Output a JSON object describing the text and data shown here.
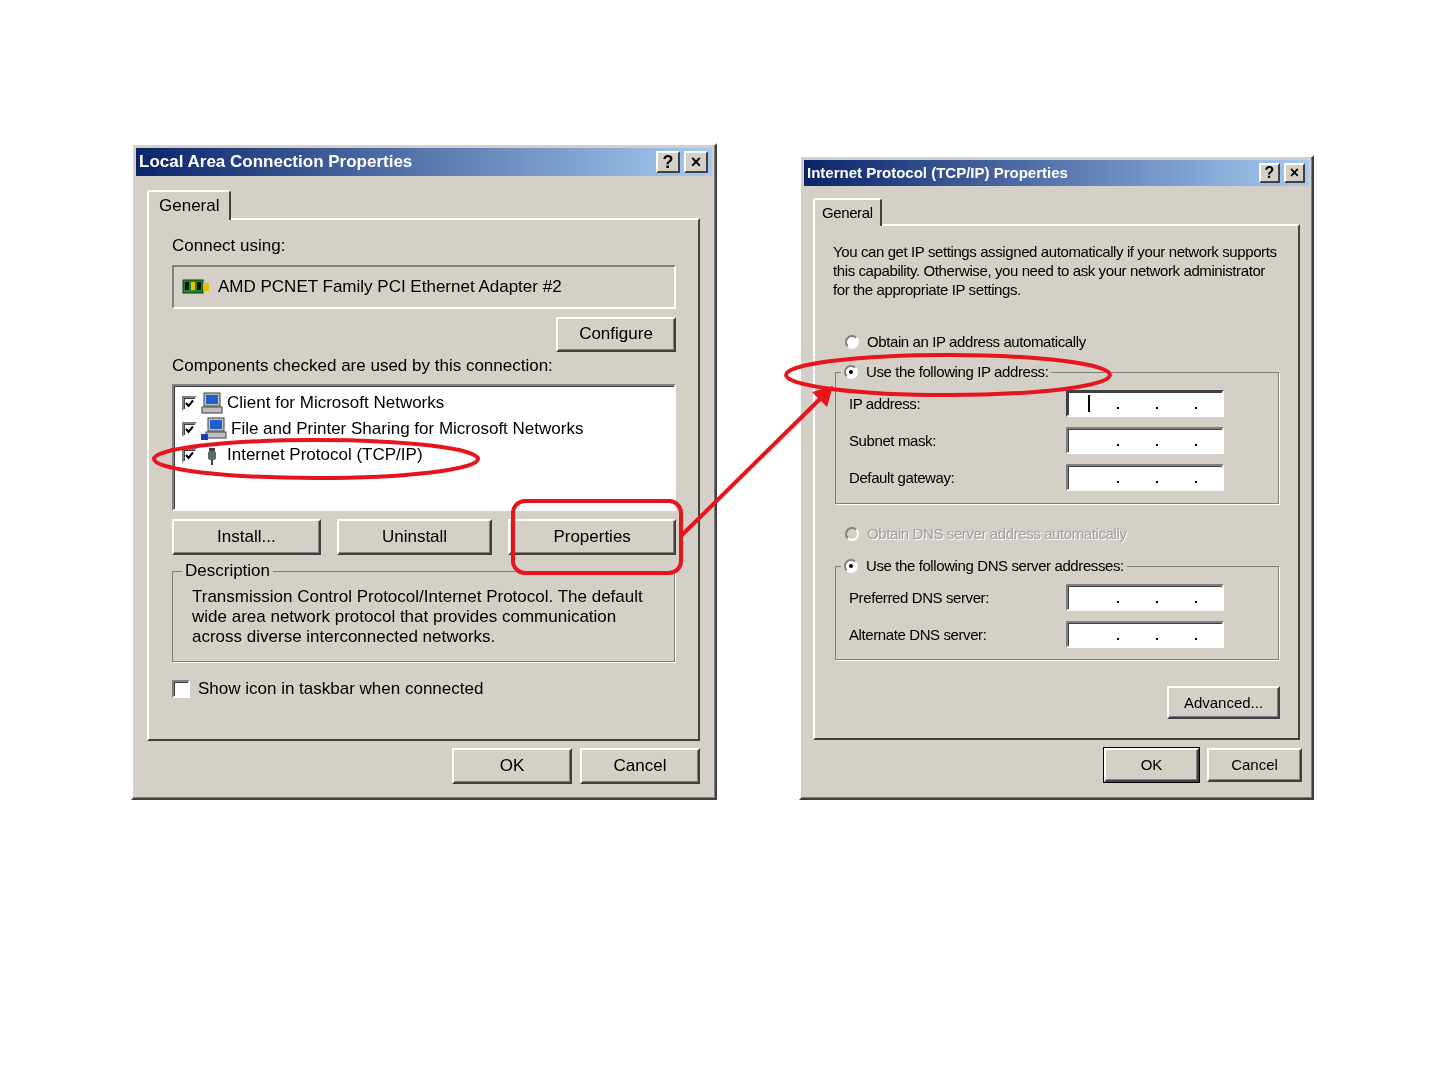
{
  "dialogs": [
    {
      "kind": "connection",
      "title": "Local Area Connection Properties",
      "title_buttons": [
        "?",
        "×"
      ],
      "tabs": [
        {
          "label": "General",
          "selected": true
        }
      ],
      "connect_label": "Connect using:",
      "adapter": "AMD PCNET Family PCI Ethernet Adapter #2",
      "configure": "Configure",
      "components_label": "Components checked are used by this connection:",
      "components": [
        {
          "label": "Client for Microsoft Networks",
          "checked": true
        },
        {
          "label": "File and Printer Sharing for Microsoft Networks",
          "checked": true
        },
        {
          "label": "Internet Protocol (TCP/IP)",
          "checked": true
        }
      ],
      "buttons": [
        "Install...",
        "Uninstall",
        "Properties"
      ],
      "description": {
        "title": "Description",
        "text": "Transmission Control Protocol/Internet Protocol. The default wide area network protocol that provides communication across diverse interconnected networks."
      },
      "taskbar_option": {
        "label": "Show icon in taskbar when connected",
        "checked": false
      },
      "footer_buttons": [
        "OK",
        "Cancel"
      ]
    },
    {
      "kind": "tcpip",
      "title": "Internet Protocol (TCP/IP) Properties",
      "title_buttons": [
        "?",
        "×"
      ],
      "tabs": [
        {
          "label": "General",
          "selected": true
        }
      ],
      "intro": "You can get IP settings assigned automatically if your network supports this capability. Otherwise, you need to ask your network administrator for the appropriate IP settings.",
      "ip_options": [
        {
          "label": "Obtain an IP address automatically",
          "selected": false,
          "disabled": false
        },
        {
          "label": "Use the following IP address:",
          "selected": true,
          "disabled": false
        }
      ],
      "ip_fields": [
        {
          "label": "IP address:",
          "focused": true
        },
        {
          "label": "Subnet mask:",
          "focused": false
        },
        {
          "label": "Default gateway:",
          "focused": false
        }
      ],
      "dns_options": [
        {
          "label": "Obtain DNS server address automatically",
          "selected": false,
          "disabled": true
        },
        {
          "label": "Use the following DNS server addresses:",
          "selected": true,
          "disabled": false
        }
      ],
      "dns_fields": [
        {
          "label": "Preferred DNS server:",
          "focused": false
        },
        {
          "label": "Alternate DNS server:",
          "focused": false
        }
      ],
      "advanced": "Advanced...",
      "footer_buttons": [
        "OK",
        "Cancel"
      ]
    }
  ]
}
